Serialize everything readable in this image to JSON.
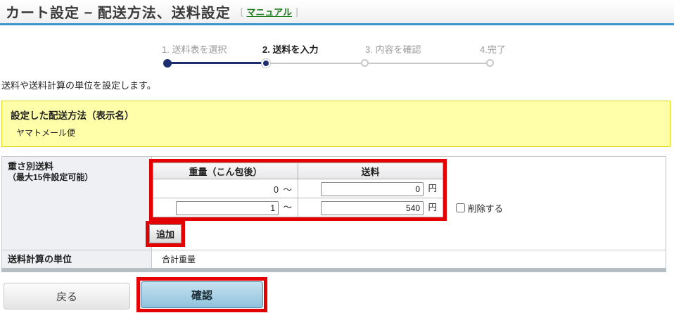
{
  "header": {
    "title": "カート設定 − 配送方法、送料設定",
    "bracket_open": "[",
    "manual_link": "マニュアル",
    "bracket_close": "]"
  },
  "stepper": {
    "steps": [
      {
        "label": "1. 送料表を選択",
        "state": "done"
      },
      {
        "label": "2. 送料を入力",
        "state": "current"
      },
      {
        "label": "3. 内容を確認",
        "state": "upcoming"
      },
      {
        "label": "4.完了",
        "state": "upcoming"
      }
    ]
  },
  "intro": {
    "description": "送料や送料計算の単位を設定します。"
  },
  "shipping_method_box": {
    "title": "設定した配送方法（表示名）",
    "value": "ヤマトメール便"
  },
  "weight_table": {
    "label": "重さ別送料",
    "sublabel": "（最大15件設定可能）",
    "col_weight": "重量（こん包後）",
    "col_fee": "送料",
    "rows": [
      {
        "weight": "0",
        "tilde": "～",
        "fee": "0",
        "unit": "円"
      },
      {
        "weight": "1",
        "tilde": "～",
        "fee": "540",
        "unit": "円",
        "delete_label": "削除する"
      }
    ],
    "add_button": "追加"
  },
  "unit_row": {
    "label": "送料計算の単位",
    "value": "合計重量"
  },
  "footer": {
    "back_button": "戻る",
    "confirm_button": "確認"
  },
  "colors": {
    "header_underline_blue": "#3e94cf",
    "step_navy": "#1b2f70",
    "step_gray": "#c9c9c9",
    "link_green": "#1e7d1e",
    "highlight_yellow_bg": "#ffffaa",
    "highlight_yellow_border": "#e3d713",
    "table_left_cell_bg": "#eef0f4",
    "annotation_red": "#e30000",
    "confirm_button_blue": "#8fc3dd"
  }
}
